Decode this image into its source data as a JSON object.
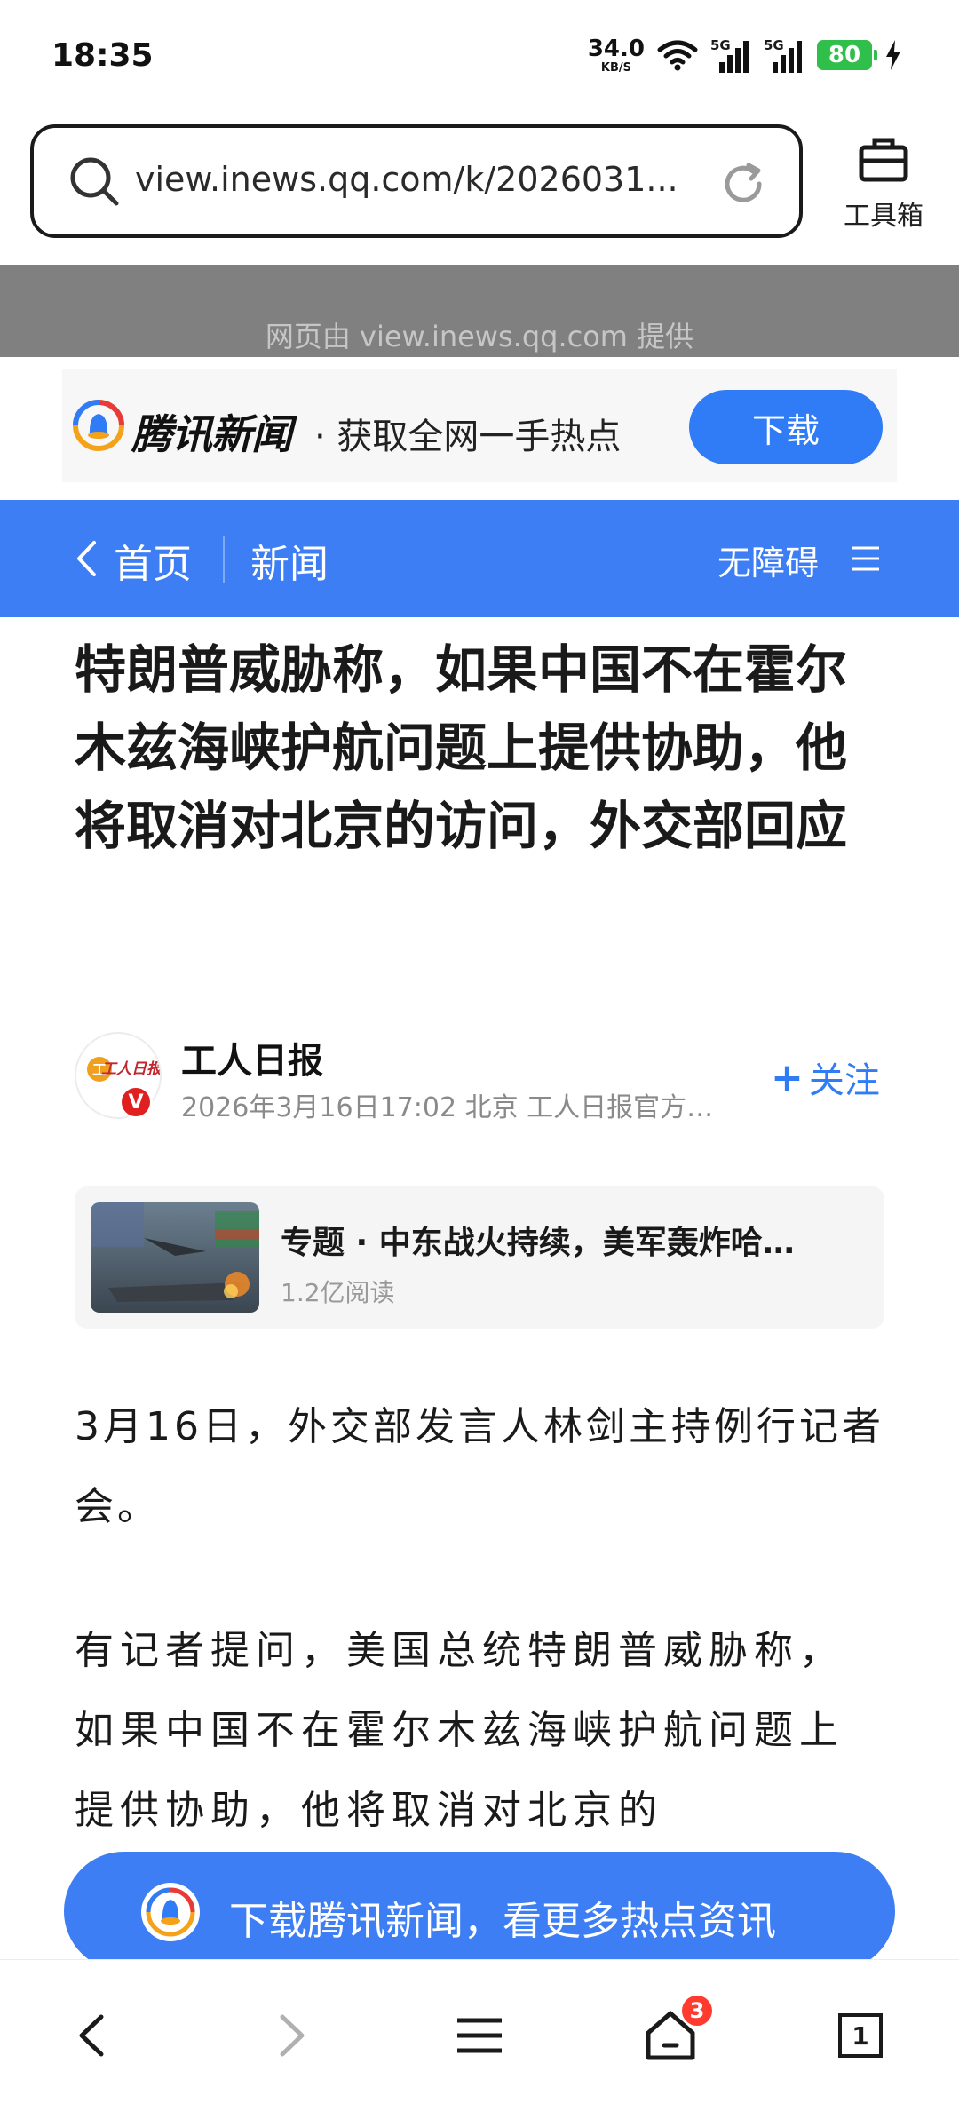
{
  "status_bar": {
    "time": "18:35",
    "net_speed_value": "34.0",
    "net_speed_unit": "KB/S",
    "sim1_label": "5G",
    "sim2_label": "5G",
    "battery_level": "80"
  },
  "browser": {
    "url": "view.inews.qq.com/k/2026031...",
    "toolbox_label": "工具箱",
    "provided_by": "网页由 view.inews.qq.com 提供"
  },
  "promo": {
    "brand": "腾讯新闻",
    "tagline": "· 获取全网一手热点",
    "download_button": "下载"
  },
  "nav": {
    "home": "首页",
    "news": "新闻",
    "accessibility": "无障碍"
  },
  "article": {
    "title": "特朗普威胁称，如果中国不在霍尔木兹海峡护航问题上提供协助，他将取消对北京的访问，外交部回应",
    "author": {
      "name": "工人日报",
      "meta": "2026年3月16日17:02  北京  工人日报官方…",
      "verified_badge": "V",
      "logo_text": "工人日报",
      "follow_label": "关注"
    },
    "topic": {
      "title": "专题 · 中东战火持续，美军轰炸哈…",
      "reads": "1.2亿阅读"
    },
    "paragraphs": [
      "3月16日，外交部发言人林剑主持例行记者会。",
      "有记者提问，美国总统特朗普威胁称，如果中国不在霍尔木兹海峡护航问题上提供协助，他将取消对北京的"
    ]
  },
  "floating_banner": {
    "text": "下载腾讯新闻，看更多热点资讯"
  },
  "bottom_nav": {
    "tab_badge": "3",
    "tab_count": "1"
  },
  "colors": {
    "accent_blue": "#3d7ef5",
    "button_blue": "#2f7cf6",
    "battery_green": "#2fbf4a",
    "badge_red": "#ff3b30"
  }
}
